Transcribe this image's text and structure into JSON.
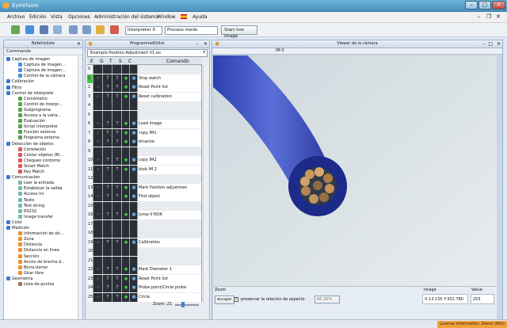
{
  "app": {
    "title": "EyeVision",
    "window_controls": [
      "–",
      "□",
      "✕"
    ]
  },
  "menu": [
    "Archivo",
    "Edición",
    "Vista",
    "Opciones",
    "Administración del sistema",
    "Window",
    "Ayuda"
  ],
  "toolbar": {
    "interpreter": "Interpreter 0",
    "process_mode": "Process mode",
    "start_live": "Start live image"
  },
  "commands": {
    "title": "Befehlsliste",
    "header": "Commands",
    "items": [
      {
        "label": "Captura de imagen",
        "level": 0,
        "color": "#3a7bd5"
      },
      {
        "label": "Captura de imagen...",
        "level": 1,
        "color": "#4a90d9"
      },
      {
        "label": "Captura de imagen...",
        "level": 1,
        "color": "#4a90d9"
      },
      {
        "label": "Control de la cámara",
        "level": 1,
        "color": "#4a90d9"
      },
      {
        "label": "Calibración",
        "level": 0,
        "color": "#3a7bd5"
      },
      {
        "label": "Filtro",
        "level": 0,
        "color": "#3a7bd5"
      },
      {
        "label": "Control de intérprete",
        "level": 0,
        "color": "#3a7bd5"
      },
      {
        "label": "Cronómetro",
        "level": 1,
        "color": "#59a14f"
      },
      {
        "label": "Control de interpr...",
        "level": 1,
        "color": "#59a14f"
      },
      {
        "label": "Subprograma",
        "level": 1,
        "color": "#59a14f"
      },
      {
        "label": "Acceso a la varia...",
        "level": 1,
        "color": "#59a14f"
      },
      {
        "label": "Evaluación",
        "level": 1,
        "color": "#59a14f"
      },
      {
        "label": "Script Interpreter",
        "level": 1,
        "color": "#59a14f"
      },
      {
        "label": "Función externa",
        "level": 1,
        "color": "#59a14f"
      },
      {
        "label": "Programa externo",
        "level": 1,
        "color": "#59a14f"
      },
      {
        "label": "Detección de objetos",
        "level": 0,
        "color": "#3a7bd5"
      },
      {
        "label": "Correlación",
        "level": 1,
        "color": "#e15759"
      },
      {
        "label": "Contar objetos (Bl...",
        "level": 1,
        "color": "#e15759"
      },
      {
        "label": "Chequeo contorno",
        "level": 1,
        "color": "#e15759"
      },
      {
        "label": "Smart Match",
        "level": 1,
        "color": "#e15759"
      },
      {
        "label": "Key Match",
        "level": 1,
        "color": "#e15759"
      },
      {
        "label": "Comunicación",
        "level": 0,
        "color": "#3a7bd5"
      },
      {
        "label": "Leer la entrada",
        "level": 1,
        "color": "#76b7b2"
      },
      {
        "label": "Establecer la salida",
        "level": 1,
        "color": "#76b7b2"
      },
      {
        "label": "Acceso Ini",
        "level": 1,
        "color": "#76b7b2"
      },
      {
        "label": "Texto",
        "level": 1,
        "color": "#76b7b2"
      },
      {
        "label": "Text string",
        "level": 1,
        "color": "#76b7b2"
      },
      {
        "label": "RS232",
        "level": 1,
        "color": "#76b7b2"
      },
      {
        "label": "Image transfer",
        "level": 1,
        "color": "#76b7b2"
      },
      {
        "label": "Color",
        "level": 0,
        "color": "#3a7bd5"
      },
      {
        "label": "Medición",
        "level": 0,
        "color": "#3a7bd5"
      },
      {
        "label": "Información de ob...",
        "level": 1,
        "color": "#f28e2b"
      },
      {
        "label": "Zona",
        "level": 1,
        "color": "#f28e2b"
      },
      {
        "label": "Distancia",
        "level": 1,
        "color": "#f28e2b"
      },
      {
        "label": "Distancia en línea",
        "level": 1,
        "color": "#f28e2b"
      },
      {
        "label": "Sección",
        "level": 1,
        "color": "#f28e2b"
      },
      {
        "label": "Ancho de brecha d...",
        "level": 1,
        "color": "#f28e2b"
      },
      {
        "label": "Borra borrar",
        "level": 1,
        "color": "#f28e2b"
      },
      {
        "label": "Girar libre",
        "level": 1,
        "color": "#f28e2b"
      },
      {
        "label": "Geometría",
        "level": 0,
        "color": "#3a7bd5"
      },
      {
        "label": "Lista de puntos",
        "level": 1,
        "color": "#9c755f"
      }
    ]
  },
  "program": {
    "title": "ProgrammeEditor",
    "name": "Example Position Adjustment V1.eo",
    "columns": [
      "E",
      "G",
      "T",
      "S",
      "C",
      "Comando"
    ],
    "rows": [
      {
        "n": "0",
        "cmd": ""
      },
      {
        "n": "1",
        "cmd": "Stop watch"
      },
      {
        "n": "2",
        "cmd": "Reset Point list"
      },
      {
        "n": "3",
        "cmd": "Reset calibration"
      },
      {
        "n": "4",
        "cmd": ""
      },
      {
        "n": "5",
        "cmd": ""
      },
      {
        "n": "6",
        "cmd": "Load image"
      },
      {
        "n": "7",
        "cmd": "copy IM1"
      },
      {
        "n": "8",
        "cmd": "binarize"
      },
      {
        "n": "9",
        "cmd": ""
      },
      {
        "n": "10",
        "cmd": "copy IM2"
      },
      {
        "n": "11",
        "cmd": "blob IM 2"
      },
      {
        "n": "12",
        "cmd": ""
      },
      {
        "n": "13",
        "cmd": "Mark Position adjustmen"
      },
      {
        "n": "14",
        "cmd": "Find object"
      },
      {
        "n": "15",
        "cmd": ""
      },
      {
        "n": "16",
        "cmd": "Jump if NOK"
      },
      {
        "n": "17",
        "cmd": ""
      },
      {
        "n": "18",
        "cmd": ""
      },
      {
        "n": "19",
        "cmd": "Calibration"
      },
      {
        "n": "20",
        "cmd": ""
      },
      {
        "n": "21",
        "cmd": ""
      },
      {
        "n": "22",
        "cmd": "Mark Diameter 1"
      },
      {
        "n": "23",
        "cmd": "Reset Point list"
      },
      {
        "n": "24",
        "cmd": "Probe point/Circle probe"
      },
      {
        "n": "25",
        "cmd": "Circle"
      }
    ],
    "zoom_label": "Zoom: 21"
  },
  "viewer": {
    "title": "Viewer de la cámara",
    "image_label": "IM 0",
    "zoom_group": "Zoom",
    "fit_button": "encajar",
    "keep_ratio": "preservar la relación de aspecto",
    "zoom_value": "66.26%",
    "image_group": "Image",
    "coords": "X:13.155  Y:301.780",
    "value_group": "Value",
    "value": "253"
  },
  "status": {
    "license": "License information: Demo (60s)"
  }
}
